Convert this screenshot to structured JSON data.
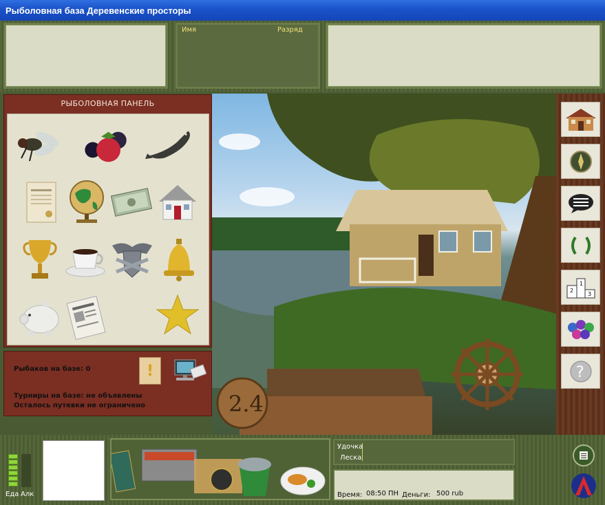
{
  "window": {
    "title": "Рыболовная база Деревенские просторы"
  },
  "top": {
    "name_label": "Имя",
    "rank_label": "Разряд"
  },
  "fishing_panel": {
    "title": "РЫБОЛОВНАЯ ПАНЕЛЬ",
    "items": [
      "fly-icon",
      "berries-icon",
      "catfish-icon",
      "certificate-icon",
      "globe-icon",
      "money-icon",
      "house-icon",
      "trophy-cup-icon",
      "coffee-cup-icon",
      "eagle-crest-icon",
      "bell-icon",
      "piggy-bank-icon",
      "newspaper-icon",
      "star-icon"
    ]
  },
  "info": {
    "fishers": "Рыбаков на базе: 0",
    "tournaments": "Турниры на базе: не объявлены",
    "vouchers": "Осталось путевки не ограничено"
  },
  "scene": {
    "sign_text": "2.4"
  },
  "sidebar": {
    "items": [
      "home-icon",
      "compass-icon",
      "chat-icon",
      "laurel-icon",
      "podium-icon",
      "grapes-icon",
      "help-icon"
    ]
  },
  "bottom": {
    "food_label": "Еда",
    "alc_label": "Алк",
    "rod_label": "Удочка",
    "line_label": "Леска",
    "time_label": "Время:",
    "time_value": "08:50 ПН",
    "money_label": "Деньги:",
    "money_value": "500 rub"
  },
  "colors": {
    "panel_red": "#7b2e22",
    "panel_beige": "#e4e2cf",
    "frame_green": "#56683b",
    "meter_green": "#8fd63a"
  }
}
